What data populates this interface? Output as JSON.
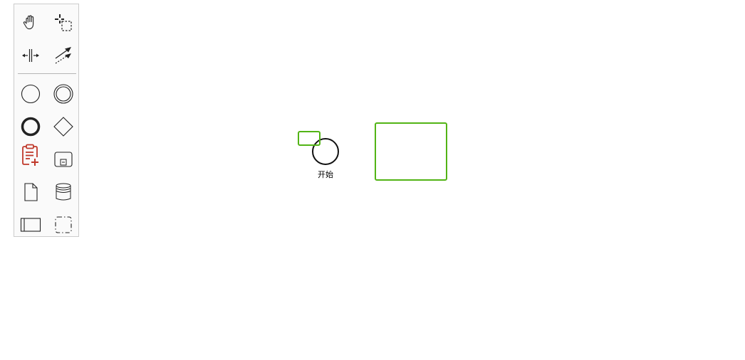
{
  "palette": {
    "tools": [
      {
        "id": "hand-tool",
        "icon": "hand-icon"
      },
      {
        "id": "lasso-tool",
        "icon": "lasso-icon"
      },
      {
        "id": "space-tool",
        "icon": "space-icon"
      },
      {
        "id": "global-connect-tool",
        "icon": "connect-icon"
      },
      {
        "id": "create-start-event",
        "icon": "start-event-icon"
      },
      {
        "id": "create-intermediate-event",
        "icon": "intermediate-event-icon"
      },
      {
        "id": "create-end-event",
        "icon": "end-event-icon"
      },
      {
        "id": "create-gateway",
        "icon": "gateway-icon"
      },
      {
        "id": "create-task",
        "icon": "task-clipboard-icon"
      },
      {
        "id": "create-subprocess",
        "icon": "subprocess-icon"
      },
      {
        "id": "create-data-object",
        "icon": "data-object-icon"
      },
      {
        "id": "create-data-store",
        "icon": "data-store-icon"
      },
      {
        "id": "create-pool",
        "icon": "pool-icon"
      },
      {
        "id": "create-group",
        "icon": "group-icon"
      }
    ],
    "colors": {
      "icon": "#333333",
      "task_icon": "#c0392b",
      "border": "#cccccc",
      "background": "#fafafa"
    }
  },
  "diagram": {
    "start_event": {
      "label": "开始"
    },
    "selection_color": "#52b415"
  }
}
